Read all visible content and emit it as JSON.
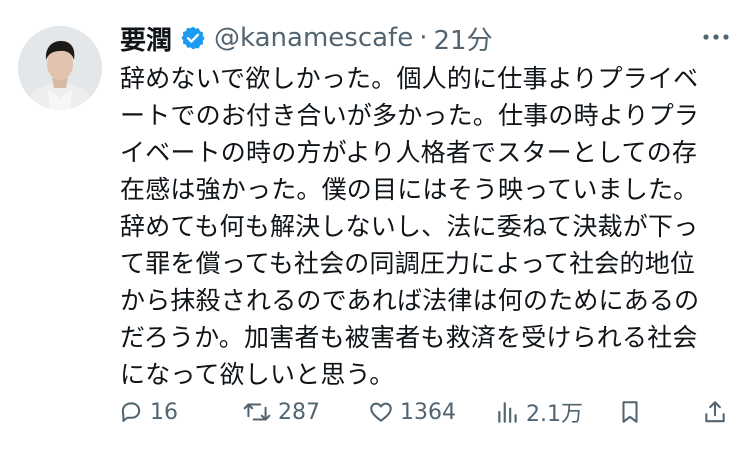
{
  "tweet": {
    "display_name": "要潤",
    "handle": "@kanamescafe",
    "separator": "·",
    "time": "21分",
    "lines": [
      "辞めないで欲しかった。個人的に仕事よりプライベ",
      "ートでのお付き合いが多かった。仕事の時よりプラ",
      "イベートの時の方がより人格者でスターとしての存",
      "在感は強かった。僕の目にはそう映っていました。",
      "辞めても何も解決しないし、法に委ねて決裁が下っ",
      "て罪を償っても社会の同調圧力によって社会的地位",
      "から抹殺されるのであれば法律は何のためにあるの",
      "だろうか。加害者も被害者も救済を受けられる社会",
      "になって欲しいと思う。"
    ]
  },
  "actions": {
    "replies": "16",
    "retweets": "287",
    "likes": "1364",
    "views": "2.1万"
  },
  "icons": {
    "verified": "verified-badge-icon",
    "more": "more-horizontal-icon",
    "reply": "reply-icon",
    "retweet": "retweet-icon",
    "like": "heart-icon",
    "views": "views-chart-icon",
    "bookmark": "bookmark-icon",
    "share": "share-icon"
  },
  "colors": {
    "verified_blue": "#1d9bf0",
    "text": "#0f1419",
    "secondary": "#536471"
  }
}
